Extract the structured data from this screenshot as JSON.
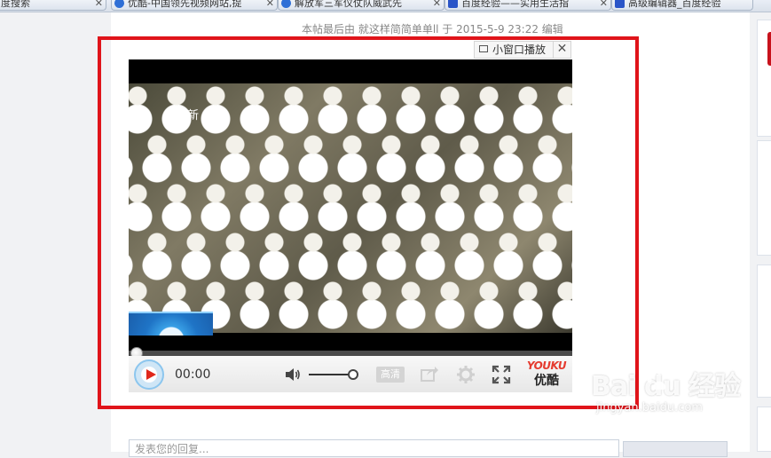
{
  "tabs": [
    {
      "label": "度搜索",
      "icon": "globe-icon"
    },
    {
      "label": "优酷-中国领先视频网站,提",
      "icon": "globe-icon"
    },
    {
      "label": "解放军三军仪仗队威武先",
      "icon": "globe-icon"
    },
    {
      "label": "百度经验——实用生活指",
      "icon": "paw-icon"
    },
    {
      "label": "高级编辑器_百度经验",
      "icon": "paw-icon"
    }
  ],
  "post": {
    "edit_meta": "本帖最后由 就这样简简单单ll 于 2015-5-9 23:22 编辑"
  },
  "player": {
    "mini_window_label": "小窗口播放",
    "mini_close_label": "✕",
    "video_overlay_text": "新 闻",
    "time_display": "00:00",
    "hd_label": "高清",
    "brand_en": "YOUKU",
    "brand_cn": "优酷",
    "progress": 0,
    "volume": 0.9
  },
  "reply": {
    "placeholder": "发表您的回复..."
  },
  "watermark": {
    "main": "Bai du 经验",
    "sub": "jingyan.baidu.com"
  },
  "colors": {
    "highlight_border": "#e0141a",
    "play_triangle": "#e0281b",
    "youku_red": "#e53b2f"
  }
}
